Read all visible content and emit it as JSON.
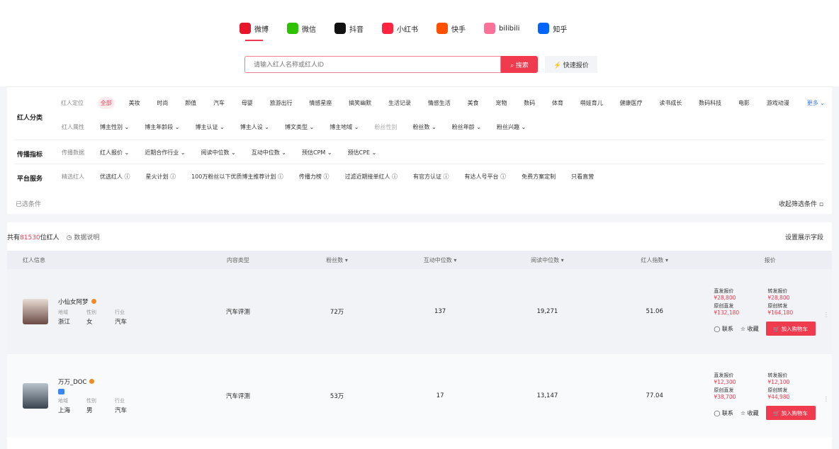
{
  "platforms": [
    {
      "label": "微博",
      "icon": "weibo-icon",
      "color": "#e6162d",
      "active": true
    },
    {
      "label": "微信",
      "icon": "wechat-icon",
      "color": "#2dc100"
    },
    {
      "label": "抖音",
      "icon": "douyin-icon",
      "color": "#111111"
    },
    {
      "label": "小红书",
      "icon": "xiaohongshu-icon",
      "color": "#ff2442"
    },
    {
      "label": "快手",
      "icon": "kuaishou-icon",
      "color": "#ff5000"
    },
    {
      "label": "bilibili",
      "icon": "bilibili-icon",
      "color": "#fb7299"
    },
    {
      "label": "知乎",
      "icon": "zhihu-icon",
      "color": "#0066ff"
    }
  ],
  "search": {
    "placeholder": "请输入红人名称或红人ID",
    "button": "搜索",
    "quote": "快速报价"
  },
  "filters": {
    "cat_label": "红人分类",
    "row1_first": "红人定位",
    "row1": [
      "全部",
      "美妆",
      "时尚",
      "颜值",
      "汽车",
      "母婴",
      "旅游出行",
      "情感星座",
      "搞笑幽默",
      "生活记录",
      "情感生活",
      "美食",
      "宠物",
      "数码",
      "体育",
      "萌娃育儿",
      "健康医疗",
      "读书成长",
      "数码科技",
      "电影",
      "游戏动漫"
    ],
    "more": "更多",
    "row2_first": "红人属性",
    "row2": [
      "博主性别",
      "博主年龄段",
      "博主认证",
      "博主人设",
      "博文类型",
      "博主地域"
    ],
    "row2_grey": "粉丝性别",
    "row2b": [
      "粉丝数",
      "粉丝年龄",
      "粉丝兴趣"
    ],
    "spread_label": "传播指标",
    "row3_first": "传播数据",
    "row3": [
      "红人报价",
      "近期合作行业",
      "阅读中位数",
      "互动中位数",
      "预估CPM",
      "预估CPE"
    ],
    "service_label": "平台服务",
    "row4_first": "精选红人",
    "row4": [
      "优选红人 ⓘ",
      "星火计划 ⓘ",
      "100万粉丝以下优质博主推荐计划 ⓘ",
      "传播力榜 ⓘ",
      "过滤近期接单红人 ⓘ",
      "有官方认证 ⓘ",
      "有达人号平台 ⓘ",
      "免费方案定制",
      "只看直营"
    ],
    "selected": "已选条件",
    "collapse": "收起筛选条件"
  },
  "results": {
    "prefix": "共有",
    "count": "81530",
    "suffix": "位红人",
    "note": "数据说明",
    "settings": "设置展示字段",
    "columns": [
      "红人信息",
      "内容类型",
      "粉丝数 ▾",
      "互动中位数 ▾",
      "阅读中位数 ▾",
      "红人指数 ▾",
      "报价"
    ],
    "meta_labels": [
      "地域",
      "性别",
      "行业"
    ],
    "price_labels": [
      "直发报价",
      "转发报价",
      "原创直发",
      "原创转发"
    ],
    "contact": "联系",
    "favorite": "收藏",
    "cart": "加入购物车",
    "rows": [
      {
        "name": "小仙女阿梦",
        "region": "浙江",
        "gender": "女",
        "industry": "汽车",
        "content": "汽车评测",
        "fans": "72万",
        "interact": "137",
        "read": "19,271",
        "index": "51.06",
        "prices": [
          "¥28,800",
          "¥28,800",
          "¥132,180",
          "¥164,180"
        ]
      },
      {
        "name": "万万_DOC",
        "region": "上海",
        "gender": "男",
        "industry": "汽车",
        "content": "汽车评测",
        "fans": "53万",
        "interact": "17",
        "read": "13,147",
        "index": "77.04",
        "prices": [
          "¥12,300",
          "¥12,100",
          "¥38,700",
          "¥44,980"
        ]
      }
    ]
  }
}
